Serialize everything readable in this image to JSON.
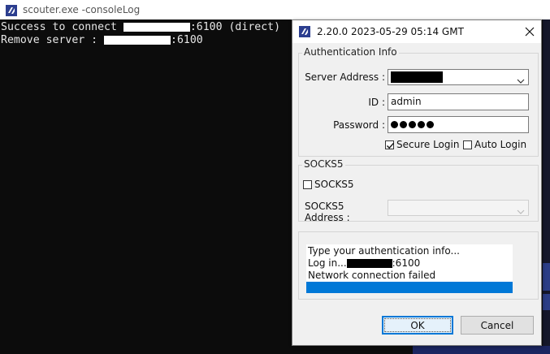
{
  "console": {
    "title": "scouter.exe  -consoleLog",
    "lines": [
      {
        "prefix": "Success to connect ",
        "suffix": ":6100 (direct)"
      },
      {
        "prefix": "Remove server : ",
        "suffix": ":6100"
      }
    ]
  },
  "dialog": {
    "title": "2.20.0 2023-05-29 05:14 GMT",
    "auth": {
      "legend": "Authentication Info",
      "server_label": "Server Address :",
      "id_label": "ID :",
      "id_value": "admin",
      "password_label": "Password :",
      "password_length": 5,
      "secure_login_label": "Secure Login",
      "secure_login_checked": true,
      "auto_login_label": "Auto Login",
      "auto_login_checked": false
    },
    "socks": {
      "legend": "SOCKS5",
      "checkbox_label": "SOCKS5",
      "checked": false,
      "address_label": "SOCKS5 Address :"
    },
    "log": {
      "line1": "Type your authentication info...",
      "line2_prefix": "Log in...",
      "line2_suffix": ":6100",
      "line3": "Network connection failed"
    },
    "ok_label": "OK",
    "cancel_label": "Cancel"
  },
  "colors": {
    "selection": "#0078d7",
    "console_bg": "#0c0c0c",
    "icon_navy": "#2c3e8f"
  }
}
